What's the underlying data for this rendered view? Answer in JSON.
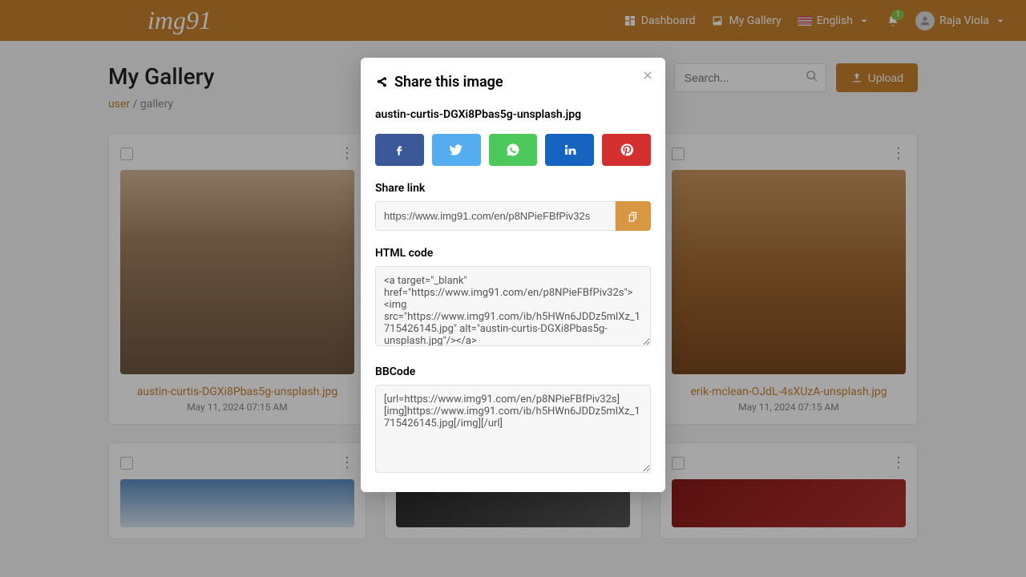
{
  "brand": "img91",
  "nav": {
    "dashboard": "Dashboard",
    "gallery": "My Gallery",
    "language": "English",
    "notification_count": "1",
    "username": "Raja Viola"
  },
  "page": {
    "title": "My Gallery",
    "breadcrumb_user": "user",
    "breadcrumb_sep": "/",
    "breadcrumb_current": "gallery"
  },
  "search": {
    "placeholder": "Search..."
  },
  "upload_label": "Upload",
  "cards": [
    {
      "title": "austin-curtis-DGXi8Pbas5g-unsplash.jpg",
      "date": "May 11, 2024 07:15 AM"
    },
    {
      "title": "erik-mclean-OJdL-4sXUzA-unsplash.jpg",
      "date": "May 11, 2024 07:15 AM"
    }
  ],
  "modal": {
    "title": "Share this image",
    "filename": "austin-curtis-DGXi8Pbas5g-unsplash.jpg",
    "share_link_label": "Share link",
    "share_link_value": "https://www.img91.com/en/p8NPieFBfPiv32s",
    "html_label": "HTML code",
    "html_value": "<a target=\"_blank\" href=\"https://www.img91.com/en/p8NPieFBfPiv32s\"><img src=\"https://www.img91.com/ib/h5HWn6JDDz5mlXz_1715426145.jpg\" alt=\"austin-curtis-DGXi8Pbas5g-unsplash.jpg\"/></a>",
    "bb_label": "BBCode",
    "bb_value": "[url=https://www.img91.com/en/p8NPieFBfPiv32s][img]https://www.img91.com/ib/h5HWn6JDDz5mlXz_1715426145.jpg[/img][/url]"
  }
}
